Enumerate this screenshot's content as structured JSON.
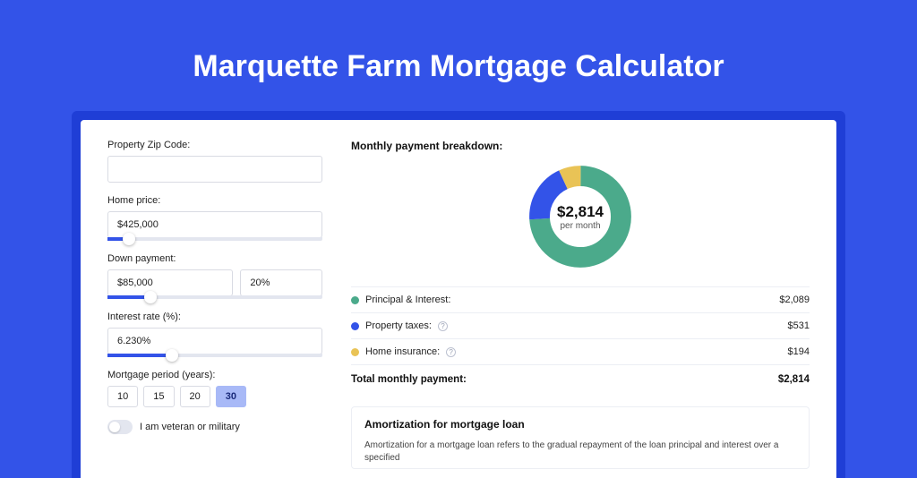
{
  "hero": {
    "title": "Marquette Farm Mortgage Calculator"
  },
  "colors": {
    "green": "#4BAA8B",
    "blue": "#3353E8",
    "yellow": "#E9C356"
  },
  "form": {
    "zip": {
      "label": "Property Zip Code:",
      "value": ""
    },
    "home_price": {
      "label": "Home price:",
      "value": "$425,000",
      "slider_percent": 10
    },
    "down_payment": {
      "label": "Down payment:",
      "value": "$85,000",
      "percent": "20%",
      "slider_percent": 20
    },
    "interest_rate": {
      "label": "Interest rate (%):",
      "value": "6.230%",
      "slider_percent": 30
    },
    "period": {
      "label": "Mortgage period (years):",
      "options": [
        "10",
        "15",
        "20",
        "30"
      ],
      "selected": "30"
    },
    "veteran": {
      "label": "I am veteran or military",
      "on": false
    }
  },
  "breakdown": {
    "title": "Monthly payment breakdown:",
    "donut": {
      "amount": "$2,814",
      "sub": "per month"
    },
    "items": [
      {
        "color": "green",
        "label": "Principal & Interest:",
        "info": false,
        "value": "$2,089"
      },
      {
        "color": "blue",
        "label": "Property taxes:",
        "info": true,
        "value": "$531"
      },
      {
        "color": "yellow",
        "label": "Home insurance:",
        "info": true,
        "value": "$194"
      }
    ],
    "total": {
      "label": "Total monthly payment:",
      "value": "$2,814"
    }
  },
  "amort": {
    "title": "Amortization for mortgage loan",
    "text": "Amortization for a mortgage loan refers to the gradual repayment of the loan principal and interest over a specified"
  },
  "chart_data": {
    "type": "pie",
    "title": "Monthly payment breakdown",
    "categories": [
      "Principal & Interest",
      "Property taxes",
      "Home insurance"
    ],
    "values": [
      2089,
      531,
      194
    ],
    "series_colors": [
      "#4BAA8B",
      "#3353E8",
      "#E9C356"
    ],
    "total": 2814,
    "center_label": "$2,814 per month"
  }
}
